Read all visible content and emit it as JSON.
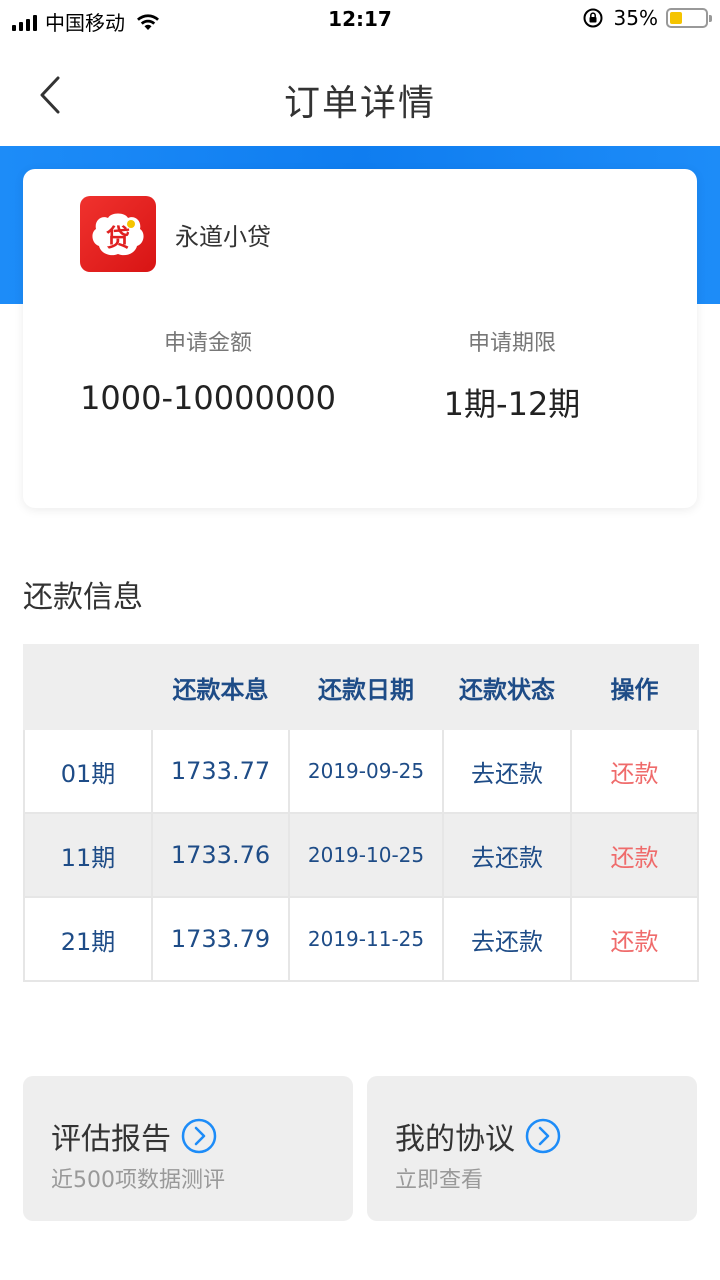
{
  "status_bar": {
    "carrier": "中国移动",
    "time": "12:17",
    "battery_percent": "35%",
    "battery_level": 0.35
  },
  "nav": {
    "back_icon": "chevron-left-icon",
    "title": "订单详情"
  },
  "product": {
    "logo_char": "贷",
    "name": "永道小贷",
    "amount_label": "申请金额",
    "amount_value": "1000-10000000",
    "term_label": "申请期限",
    "term_value": "1期-12期"
  },
  "repayment": {
    "section_title": "还款信息",
    "columns": [
      "",
      "还款本息",
      "还款日期",
      "还款状态",
      "操作"
    ],
    "rows": [
      {
        "period": "01期",
        "amount": "1733.77",
        "date": "2019-09-25",
        "status": "去还款",
        "action": "还款"
      },
      {
        "period": "11期",
        "amount": "1733.76",
        "date": "2019-10-25",
        "status": "去还款",
        "action": "还款"
      },
      {
        "period": "21期",
        "amount": "1733.79",
        "date": "2019-11-25",
        "status": "去还款",
        "action": "还款"
      }
    ]
  },
  "cards": [
    {
      "title": "评估报告",
      "subtitle": "近500项数据测评",
      "icon": "circle-chevron-right-icon"
    },
    {
      "title": "我的协议",
      "subtitle": "立即查看",
      "icon": "circle-chevron-right-icon"
    }
  ],
  "colors": {
    "accent_blue": "#1d8cf8",
    "table_text": "#1e4c87",
    "action_red": "#ef6b6b",
    "logo_red": "#e02020"
  }
}
